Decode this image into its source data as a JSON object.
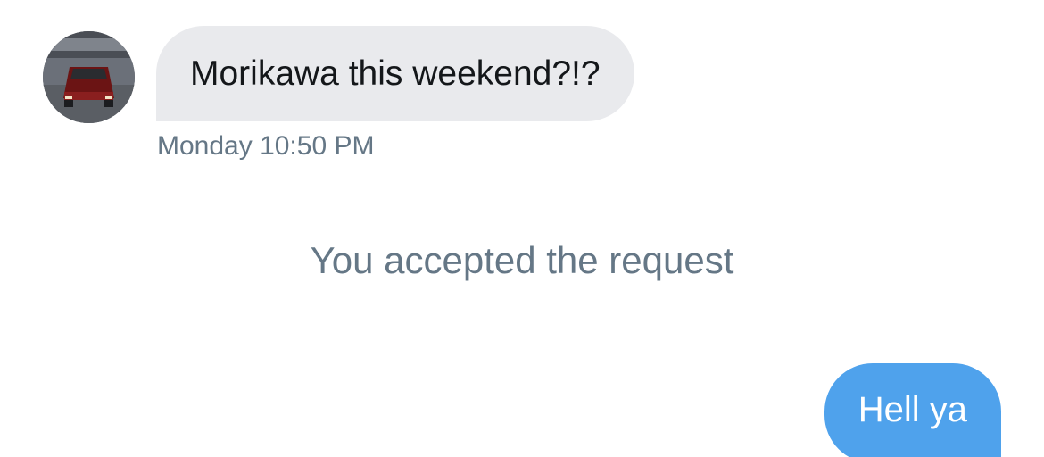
{
  "messages": {
    "incoming": {
      "text": "Morikawa this weekend?!?",
      "timestamp": "Monday 10:50 PM",
      "avatar_icon": "car-photo-icon"
    },
    "system": {
      "text": "You accepted the request"
    },
    "outgoing": {
      "text": "Hell ya"
    }
  },
  "colors": {
    "incoming_bubble": "#e9eaed",
    "outgoing_bubble": "#4fa2ec",
    "meta_text": "#657786",
    "body_text": "#14171a"
  }
}
